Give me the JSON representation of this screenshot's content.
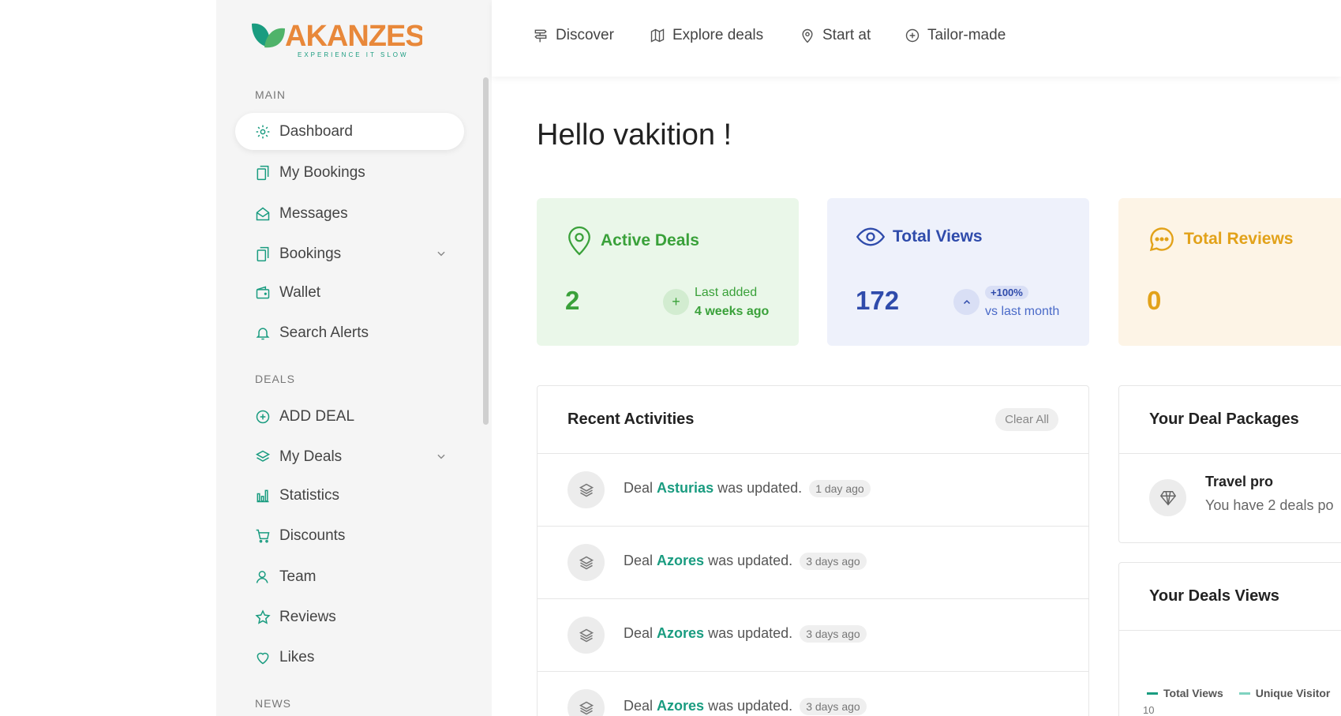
{
  "brand": {
    "name": "AKANZES",
    "tagline": "EXPERIENCE IT SLOW"
  },
  "colors": {
    "accent": "#1a9c80",
    "green": "#3aa13a",
    "blue": "#2f4bab",
    "orange": "#e2a21a"
  },
  "topnav": {
    "items": [
      {
        "label": "Discover",
        "icon": "signpost-icon"
      },
      {
        "label": "Explore deals",
        "icon": "map-icon"
      },
      {
        "label": "Start at",
        "icon": "location-pin-icon"
      },
      {
        "label": "Tailor-made",
        "icon": "plus-circle-icon"
      }
    ]
  },
  "sidebar": {
    "sections": [
      "MAIN",
      "DEALS",
      "NEWS"
    ],
    "main_items": [
      {
        "label": "Dashboard",
        "icon": "gear-icon"
      },
      {
        "label": "My Bookings",
        "icon": "documents-icon"
      },
      {
        "label": "Messages",
        "icon": "envelope-icon"
      },
      {
        "label": "Bookings",
        "icon": "documents-icon"
      },
      {
        "label": "Wallet",
        "icon": "wallet-icon"
      },
      {
        "label": "Search Alerts",
        "icon": "bell-icon"
      }
    ],
    "deal_items": [
      {
        "label": "ADD DEAL",
        "icon": "plus-circle-icon"
      },
      {
        "label": "My Deals",
        "icon": "layers-icon"
      },
      {
        "label": "Statistics",
        "icon": "bar-chart-icon"
      },
      {
        "label": "Discounts",
        "icon": "cart-icon"
      },
      {
        "label": "Team",
        "icon": "user-icon"
      },
      {
        "label": "Reviews",
        "icon": "star-icon"
      },
      {
        "label": "Likes",
        "icon": "heart-icon"
      }
    ]
  },
  "greeting": "Hello vakition !",
  "stats": {
    "active_deals": {
      "title": "Active Deals",
      "value": "2",
      "line1": "Last added",
      "line2": "4 weeks ago"
    },
    "total_views": {
      "title": "Total Views",
      "value": "172",
      "badge": "+100%",
      "line2": "vs last month"
    },
    "total_reviews": {
      "title": "Total Reviews",
      "value": "0"
    }
  },
  "activities": {
    "title": "Recent Activities",
    "clear_label": "Clear All",
    "items": [
      {
        "prefix": "Deal",
        "deal": "Asturias",
        "suffix": "was updated.",
        "time": "1 day ago"
      },
      {
        "prefix": "Deal",
        "deal": "Azores",
        "suffix": "was updated.",
        "time": "3 days ago"
      },
      {
        "prefix": "Deal",
        "deal": "Azores",
        "suffix": "was updated.",
        "time": "3 days ago"
      },
      {
        "prefix": "Deal",
        "deal": "Azores",
        "suffix": "was updated.",
        "time": "3 days ago"
      }
    ]
  },
  "packages": {
    "title": "Your Deal Packages",
    "name": "Travel pro",
    "desc": "You have 2 deals po"
  },
  "views_chart": {
    "title": "Your Deals Views",
    "legend": [
      "Total Views",
      "Unique Visitor"
    ],
    "first_tick": "10"
  }
}
